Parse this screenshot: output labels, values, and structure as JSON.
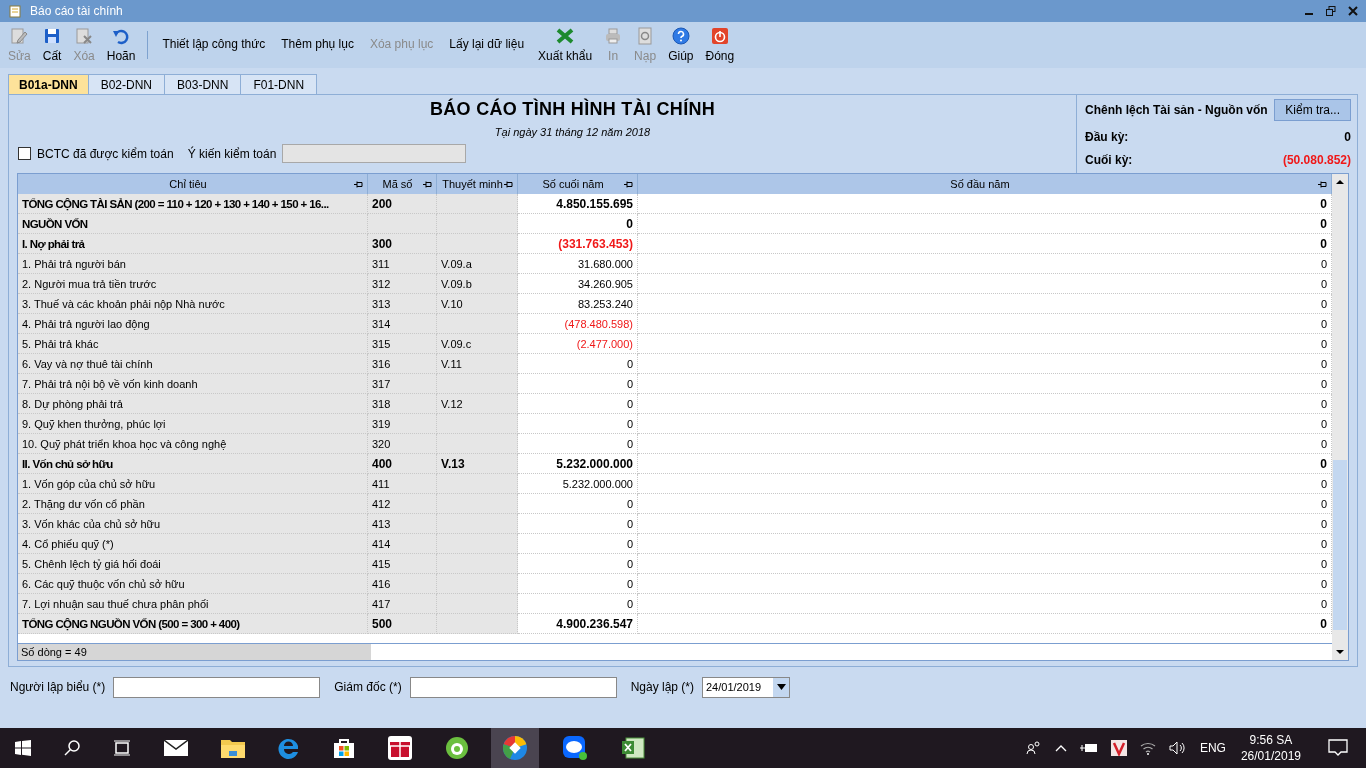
{
  "window": {
    "title": "Báo cáo tài chính"
  },
  "toolbar": [
    {
      "label": "Sửa",
      "kind": "icon",
      "disabled": true
    },
    {
      "label": "Cất",
      "kind": "icon",
      "disabled": false
    },
    {
      "label": "Xóa",
      "kind": "icon",
      "disabled": true
    },
    {
      "label": "Hoãn",
      "kind": "icon",
      "disabled": false
    },
    {
      "label": "Thiết lập công thức",
      "kind": "text",
      "disabled": false
    },
    {
      "label": "Thêm phụ lục",
      "kind": "text",
      "disabled": false
    },
    {
      "label": "Xóa phụ lục",
      "kind": "text",
      "disabled": true
    },
    {
      "label": "Lấy lại dữ liệu",
      "kind": "text",
      "disabled": false
    },
    {
      "label": "Xuất khẩu",
      "kind": "icon",
      "disabled": false
    },
    {
      "label": "In",
      "kind": "icon",
      "disabled": true
    },
    {
      "label": "Nạp",
      "kind": "icon",
      "disabled": true
    },
    {
      "label": "Giúp",
      "kind": "icon",
      "disabled": false
    },
    {
      "label": "Đóng",
      "kind": "icon",
      "disabled": false
    }
  ],
  "tabs": [
    {
      "label": "B01a-DNN",
      "selected": true
    },
    {
      "label": "B02-DNN",
      "selected": false
    },
    {
      "label": "B03-DNN",
      "selected": false
    },
    {
      "label": "F01-DNN",
      "selected": false
    }
  ],
  "report": {
    "title": "BÁO CÁO TÌNH HÌNH TÀI CHÍNH",
    "date": "Tại ngày 31 tháng 12 năm 2018",
    "audited": {
      "label": "BCTC đã được kiểm toán",
      "checked": false
    },
    "audit_opinion": {
      "label": "Ý kiến kiểm toán"
    }
  },
  "difference": {
    "title": "Chênh lệch Tài sản - Nguồn vốn",
    "button": "Kiểm tra...",
    "rows": [
      {
        "label": "Đầu kỳ:",
        "value": "0",
        "negative": false
      },
      {
        "label": "Cuối kỳ:",
        "value": "(50.080.852)",
        "negative": true
      }
    ]
  },
  "table": {
    "columns": [
      "Chỉ tiêu",
      "Mã số",
      "Thuyết minh",
      "Số cuối năm",
      "Số đầu năm"
    ],
    "rows": [
      {
        "name": "TỔNG CỘNG TÀI SẢN (200 = 110 + 120 + 130 + 140 + 150 + 16...",
        "code": "200",
        "end": "4.850.155.695",
        "start": "0",
        "bold": true,
        "end_negative": false
      },
      {
        "name": "NGUỒN VỐN",
        "end": "0",
        "start": "0",
        "bold": true,
        "end_negative": false
      },
      {
        "name": "I. Nợ phải trả",
        "code": "300",
        "end": "(331.763.453)",
        "start": "0",
        "bold": true,
        "end_negative": true
      },
      {
        "name": "1. Phải trả người bán",
        "code": "311",
        "note": "V.09.a",
        "end": "31.680.000",
        "start": "0",
        "bold": false,
        "end_negative": false
      },
      {
        "name": "2. Người mua trả tiền trước",
        "code": "312",
        "note": "V.09.b",
        "end": "34.260.905",
        "start": "0",
        "bold": false,
        "end_negative": false
      },
      {
        "name": "3. Thuế và các khoản phải nộp Nhà nước",
        "code": "313",
        "note": "V.10",
        "end": "83.253.240",
        "start": "0",
        "bold": false,
        "end_negative": false
      },
      {
        "name": "4. Phải trả người lao động",
        "code": "314",
        "end": "(478.480.598)",
        "start": "0",
        "bold": false,
        "end_negative": true
      },
      {
        "name": "5. Phải trả khác",
        "code": "315",
        "note": "V.09.c",
        "end": "(2.477.000)",
        "start": "0",
        "bold": false,
        "end_negative": true
      },
      {
        "name": "6. Vay và nợ thuê tài chính",
        "code": "316",
        "note": "V.11",
        "end": "0",
        "start": "0",
        "bold": false,
        "end_negative": false
      },
      {
        "name": "7. Phải trả nội bộ về vốn kinh doanh",
        "code": "317",
        "end": "0",
        "start": "0",
        "bold": false,
        "end_negative": false
      },
      {
        "name": "8. Dự phòng phải trả",
        "code": "318",
        "note": "V.12",
        "end": "0",
        "start": "0",
        "bold": false,
        "end_negative": false
      },
      {
        "name": "9. Quỹ khen thưởng, phúc lợi",
        "code": "319",
        "end": "0",
        "start": "0",
        "bold": false,
        "end_negative": false
      },
      {
        "name": "10. Quỹ phát triển khoa học và công nghệ",
        "code": "320",
        "end": "0",
        "start": "0",
        "bold": false,
        "end_negative": false
      },
      {
        "name": "II. Vốn chủ sở hữu",
        "code": "400",
        "note": "V.13",
        "end": "5.232.000.000",
        "start": "0",
        "bold": true,
        "end_negative": false
      },
      {
        "name": "1. Vốn góp của chủ sở hữu",
        "code": "411",
        "end": "5.232.000.000",
        "start": "0",
        "bold": false,
        "end_negative": false
      },
      {
        "name": "2. Thặng dư vốn cổ phần",
        "code": "412",
        "end": "0",
        "start": "0",
        "bold": false,
        "end_negative": false
      },
      {
        "name": "3. Vốn khác của chủ sở hữu",
        "code": "413",
        "end": "0",
        "start": "0",
        "bold": false,
        "end_negative": false
      },
      {
        "name": "4. Cổ phiếu quỹ (*)",
        "code": "414",
        "end": "0",
        "start": "0",
        "bold": false,
        "end_negative": false
      },
      {
        "name": "5. Chênh lệch tỷ giá hối đoái",
        "code": "415",
        "end": "0",
        "start": "0",
        "bold": false,
        "end_negative": false
      },
      {
        "name": "6. Các quỹ thuộc vốn chủ sở hữu",
        "code": "416",
        "end": "0",
        "start": "0",
        "bold": false,
        "end_negative": false
      },
      {
        "name": "7. Lợi nhuận sau thuế chưa phân phối",
        "code": "417",
        "end": "0",
        "start": "0",
        "bold": false,
        "end_negative": false
      },
      {
        "name": "TỔNG CỘNG NGUỒN VỐN (500 = 300 + 400)",
        "code": "500",
        "end": "4.900.236.547",
        "start": "0",
        "bold": true,
        "end_negative": false
      }
    ],
    "footer": "Số dòng = 49"
  },
  "signers": [
    {
      "label": "Người lập biểu (*)"
    },
    {
      "label": "Giám đốc (*)"
    }
  ],
  "date_field": {
    "label": "Ngày lập (*)",
    "value": "24/01/2019"
  },
  "taskbar": {
    "language": "ENG",
    "time": "9:56 SA",
    "date": "26/01/2019"
  }
}
